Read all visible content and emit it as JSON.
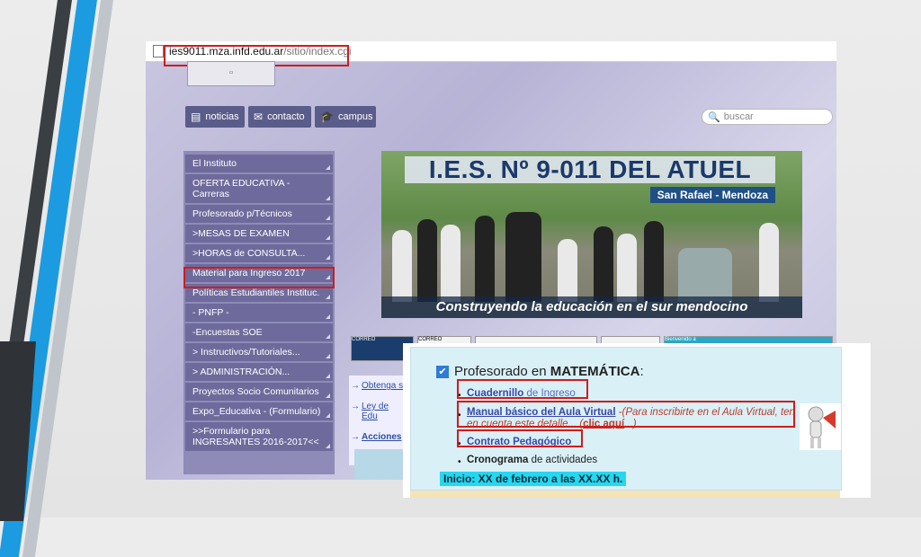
{
  "colors": {
    "highlight": "#d01c1c",
    "sidebar": "#6e6b9c",
    "accent_blue": "#1d9be0",
    "start_bg": "#26d7ef"
  },
  "browser": {
    "host": "ies9011.mza.infd.edu.ar",
    "path": "/sitio/index.cgi"
  },
  "nav": {
    "noticias": "noticias",
    "contacto": "contacto",
    "campus": "campus",
    "search_placeholder": "buscar"
  },
  "sidebar": {
    "items": [
      {
        "label": "El Instituto"
      },
      {
        "label": "OFERTA EDUCATIVA - Carreras"
      },
      {
        "label": "Profesorado p/Técnicos"
      },
      {
        "label": ">MESAS DE EXAMEN"
      },
      {
        "label": ">HORAS de CONSULTA..."
      },
      {
        "label": "Material para Ingreso 2017"
      },
      {
        "label": "Políticas Estudiantiles Instituc."
      },
      {
        "label": "- PNFP -"
      },
      {
        "label": "-Encuestas SOE"
      },
      {
        "label": "> Instructivos/Tutoriales..."
      },
      {
        "label": "> ADMINISTRACIÓN..."
      },
      {
        "label": "Proyectos Socio Comunitarios"
      },
      {
        "label": "Expo_Educativa - (Formulario)"
      },
      {
        "label": ">>Formulario para INGRESANTES 2016-2017<<"
      }
    ]
  },
  "banner": {
    "title": "I.E.S. Nº 9-011 DEL ATUEL",
    "subtitle": "San Rafael - Mendoza",
    "slogan": "Construyendo la educación en el sur mendocino"
  },
  "links": {
    "items": [
      "Obtenga s",
      "Ley de Edu",
      "Acciones"
    ]
  },
  "tiles": {
    "correo1": "CORREO",
    "correo2": "CORREO",
    "bienvenido": "Bienvenido a"
  },
  "inset": {
    "section_prefix": "Profesorado en ",
    "section_bold": "MATEMÁTICA",
    "section_suffix": ":",
    "item1_link": "Cuadernillo",
    "item1_rest": " de Ingreso",
    "item2_link": "Manual básico del Aula Virtual",
    "item2_warn": " -(Para inscribirte en el Aula Virtual, ten en cuenta este detalle... (",
    "item2_click": "clic aquí",
    "item2_end": "...)",
    "item3_link": "Contrato Pedagógico",
    "item4_bold": "Cronograma",
    "item4_rest": " de actividades",
    "start": "Inicio:  XX de febrero a las XX.XX h."
  }
}
